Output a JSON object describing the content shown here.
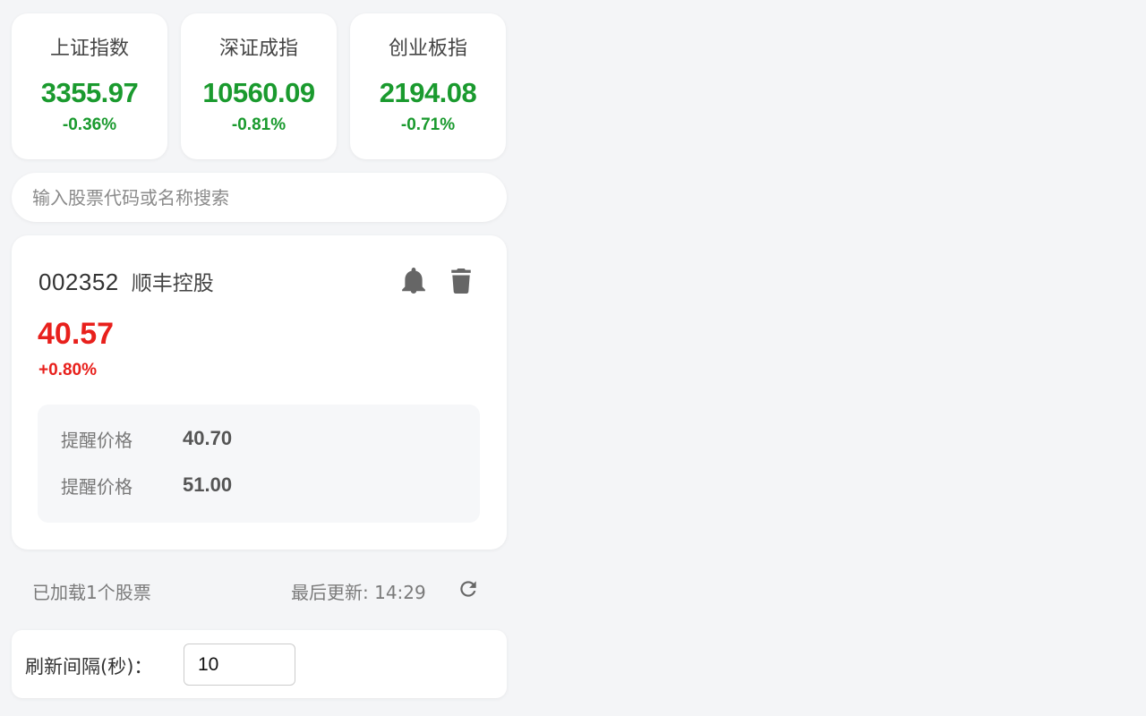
{
  "indices": [
    {
      "name": "上证指数",
      "value": "3355.97",
      "change": "-0.36%"
    },
    {
      "name": "深证成指",
      "value": "10560.09",
      "change": "-0.81%"
    },
    {
      "name": "创业板指",
      "value": "2194.08",
      "change": "-0.71%"
    }
  ],
  "search": {
    "placeholder": "输入股票代码或名称搜索"
  },
  "stock": {
    "code": "002352",
    "name": "顺丰控股",
    "price": "40.57",
    "change": "+0.80%",
    "alerts": [
      {
        "label": "提醒价格",
        "value": "40.70"
      },
      {
        "label": "提醒价格",
        "value": "51.00"
      }
    ],
    "icons": {
      "alert": "bell-icon",
      "delete": "trash-icon"
    }
  },
  "status": {
    "loaded": "已加载1个股票",
    "last_update": "最后更新: 14:29",
    "refresh_icon": "refresh-icon"
  },
  "settings": {
    "interval_label": "刷新间隔(秒)：",
    "interval_value": "10"
  },
  "colors": {
    "down": "#1a9a2e",
    "up": "#e8201c",
    "icon": "#666666",
    "background": "#f4f5f7"
  }
}
